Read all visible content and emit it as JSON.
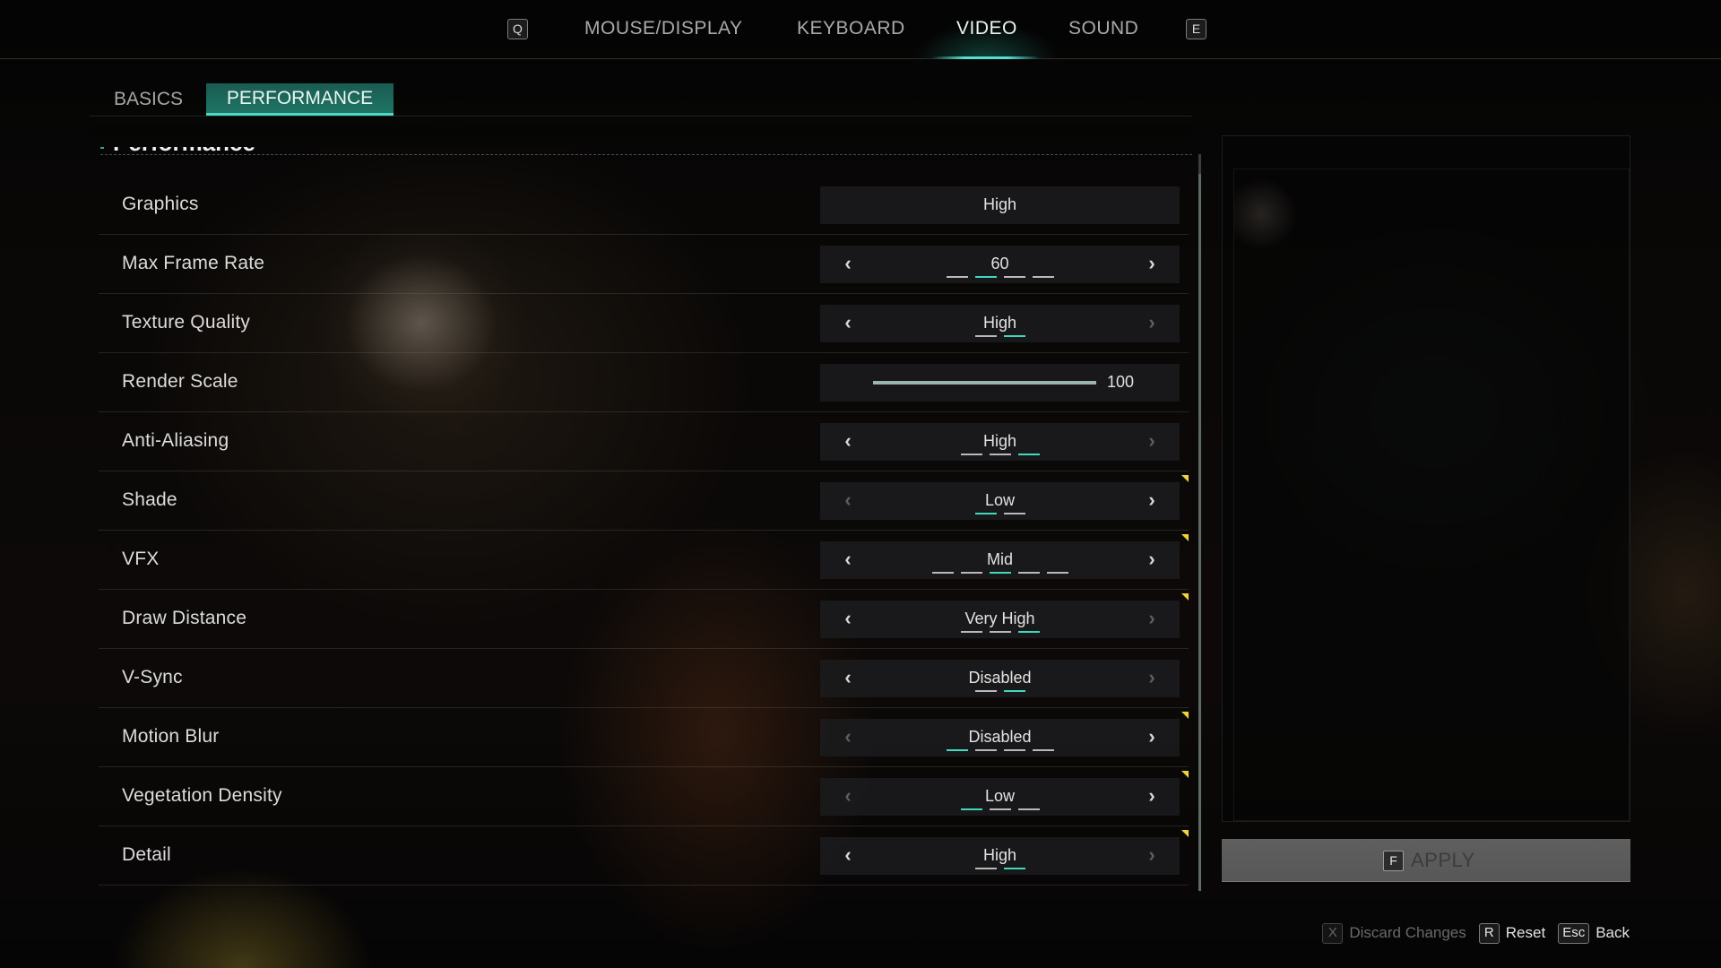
{
  "top_nav": {
    "prev_key": "Q",
    "next_key": "E",
    "tabs": [
      {
        "label": "MOUSE/DISPLAY",
        "active": false
      },
      {
        "label": "KEYBOARD",
        "active": false
      },
      {
        "label": "VIDEO",
        "active": true
      },
      {
        "label": "SOUND",
        "active": false
      }
    ],
    "accent_color": "#4fe3cf"
  },
  "sub_tabs": [
    {
      "label": "BASICS",
      "active": false
    },
    {
      "label": "PERFORMANCE",
      "active": true
    }
  ],
  "section": {
    "title": "Performance"
  },
  "settings": [
    {
      "label": "Graphics",
      "type": "display",
      "value": "High"
    },
    {
      "label": "Max Frame Rate",
      "type": "selector",
      "value": "60",
      "options_count": 4,
      "selected_index": 1,
      "left_enabled": true,
      "right_enabled": true,
      "changed": false
    },
    {
      "label": "Texture Quality",
      "type": "selector",
      "value": "High",
      "options_count": 2,
      "selected_index": 1,
      "left_enabled": true,
      "right_enabled": false,
      "changed": false
    },
    {
      "label": "Render Scale",
      "type": "slider",
      "value": "100",
      "fraction": 1.0
    },
    {
      "label": "Anti-Aliasing",
      "type": "selector",
      "value": "High",
      "options_count": 3,
      "selected_index": 2,
      "left_enabled": true,
      "right_enabled": false,
      "changed": false
    },
    {
      "label": "Shade",
      "type": "selector",
      "value": "Low",
      "options_count": 2,
      "selected_index": 0,
      "left_enabled": false,
      "right_enabled": true,
      "changed": true
    },
    {
      "label": "VFX",
      "type": "selector",
      "value": "Mid",
      "options_count": 5,
      "selected_index": 2,
      "left_enabled": true,
      "right_enabled": true,
      "changed": true
    },
    {
      "label": "Draw Distance",
      "type": "selector",
      "value": "Very High",
      "options_count": 3,
      "selected_index": 2,
      "left_enabled": true,
      "right_enabled": false,
      "changed": true
    },
    {
      "label": "V-Sync",
      "type": "selector",
      "value": "Disabled",
      "options_count": 2,
      "selected_index": 1,
      "left_enabled": true,
      "right_enabled": false,
      "changed": false
    },
    {
      "label": "Motion Blur",
      "type": "selector",
      "value": "Disabled",
      "options_count": 4,
      "selected_index": 0,
      "left_enabled": false,
      "right_enabled": true,
      "changed": true
    },
    {
      "label": "Vegetation Density",
      "type": "selector",
      "value": "Low",
      "options_count": 3,
      "selected_index": 0,
      "left_enabled": false,
      "right_enabled": true,
      "changed": true
    },
    {
      "label": "Detail",
      "type": "selector",
      "value": "High",
      "options_count": 2,
      "selected_index": 1,
      "left_enabled": true,
      "right_enabled": false,
      "changed": true
    }
  ],
  "icons": {
    "left_arrow": "‹",
    "right_arrow": "›"
  },
  "apply": {
    "key": "F",
    "label": "APPLY",
    "enabled": false
  },
  "footer": [
    {
      "key": "X",
      "label": "Discard Changes",
      "enabled": false
    },
    {
      "key": "R",
      "label": "Reset",
      "enabled": true
    },
    {
      "key": "Esc",
      "label": "Back",
      "enabled": true
    }
  ],
  "colors": {
    "tick_active": "#3fd9bd",
    "changed_flag": "#f0d23a",
    "tab_active_bg": "#1f7565"
  }
}
